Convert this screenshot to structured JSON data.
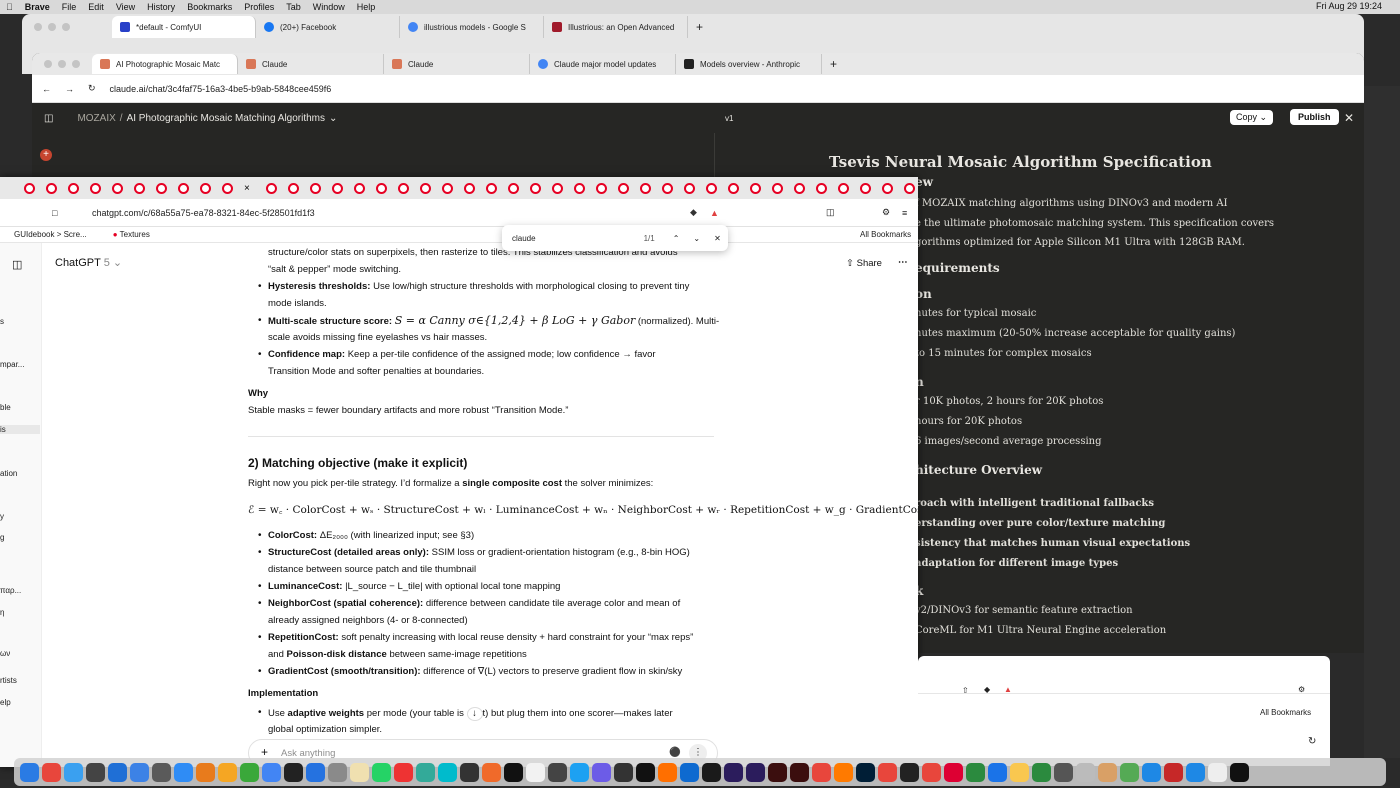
{
  "menubar": {
    "app": "Brave",
    "items": [
      "File",
      "Edit",
      "View",
      "History",
      "Bookmarks",
      "Profiles",
      "Tab",
      "Window",
      "Help"
    ],
    "clock": "Fri Aug 29  19:24"
  },
  "window_back": {
    "tabs": [
      "*default - ComfyUI",
      "(20+) Facebook",
      "illustrious models - Google S",
      "Illustrious: an Open Advanced"
    ]
  },
  "window_claude": {
    "tabs": [
      "AI Photographic Mosaic Matc",
      "Claude",
      "Claude",
      "Claude major model updates",
      "Models overview - Anthropic"
    ],
    "url": "claude.ai/chat/3c4faf75-16a3-4be5-b9ab-5848cee459f6",
    "breadcrumb_project": "MOZAIX",
    "breadcrumb_sep": "/",
    "chat_title": "AI Photographic Mosaic Matching Algorithms",
    "version": "v1",
    "copy_label": "Copy",
    "publish_label": "Publish",
    "artifact": {
      "title": "Tsevis Neural Mosaic Algorithm Specification",
      "lines": [
        {
          "t": "ew",
          "k": "h"
        },
        {
          "t": "f MOZAIX matching algorithms using DINOv3 and modern AI",
          "k": "p"
        },
        {
          "t": "e the ultimate photomosaic matching system. This specification covers",
          "k": "p"
        },
        {
          "t": "gorithms optimized for Apple Silicon M1 Ultra with 128GB RAM.",
          "k": "p"
        },
        {
          "t": "equirements",
          "k": "h"
        },
        {
          "t": "on",
          "k": "h"
        },
        {
          "t": "nutes for typical mosaic",
          "k": "p"
        },
        {
          "t": "nutes maximum (20-50% increase acceptable for quality gains)",
          "k": "p"
        },
        {
          "t": "to 15 minutes for complex mosaics",
          "k": "p"
        },
        {
          "t": "n",
          "k": "h"
        },
        {
          "t": "r 10K photos, 2 hours for 20K photos",
          "k": "p"
        },
        {
          "t": "hours for 20K photos",
          "k": "p"
        },
        {
          "t": "6 images/second average processing",
          "k": "p"
        },
        {
          "t": "hitecture Overview",
          "k": "h"
        },
        {
          "t": "roach with intelligent traditional fallbacks",
          "k": "pb"
        },
        {
          "t": "erstanding over pure color/texture matching",
          "k": "pb"
        },
        {
          "t": "sistency that matches human visual expectations",
          "k": "pb"
        },
        {
          "t": "adaptation for different image types",
          "k": "pb"
        },
        {
          "t": "k",
          "k": "h"
        },
        {
          "t": "v2/DINOv3 for semantic feature extraction",
          "k": "p"
        },
        {
          "t": "CoreML for M1 Ultra Neural Engine acceleration",
          "k": "p"
        }
      ]
    }
  },
  "window_chatgpt": {
    "url": "chatgpt.com/c/68a55a75-ea78-8321-84ec-5f28501fd1f3",
    "bookmarks": [
      "GUIdebook > Scre...",
      "Textures"
    ],
    "all_bookmarks": "All Bookmarks",
    "model": "ChatGPT",
    "model_version": "5",
    "share_label": "Share",
    "find": {
      "query": "claude",
      "count": "1/1"
    },
    "sidebar_items": [
      "s",
      "mpar...",
      "ble",
      "is",
      "ation",
      "y",
      "g",
      "παρ...",
      "η",
      "ων",
      "rtists",
      "elp"
    ],
    "content": {
      "l1": "structure/color stats on superpixels, then rasterize to tiles. This stabilizes classification and avoids",
      "l2": "“salt & pepper” mode switching.",
      "hyst_b": "Hysteresis thresholds:",
      "hyst_t": " Use low/high structure thresholds with morphological closing to prevent tiny",
      "hyst_2": "mode islands.",
      "ms_b": "Multi-scale structure score:",
      "ms_math": "S = α Canny σ∈{1,2,4} + β LoG + γ Gabor",
      "ms_t": " (normalized). Multi-",
      "ms_2": "scale avoids missing fine eyelashes vs hair masses.",
      "conf_b": "Confidence map:",
      "conf_t": " Keep a per-tile confidence of the assigned mode; low confidence → favor",
      "conf_2": "Transition Mode and softer penalties at boundaries.",
      "why_h": "Why",
      "why_t": "Stable masks = fewer boundary artifacts and more robust “Transition Mode.”",
      "sec_h": "2) Matching objective (make it explicit)",
      "sec_p1": "Right now you pick per-tile strategy. I’d formalize a ",
      "sec_pb": "single composite cost",
      "sec_p2": " the solver minimizes:",
      "eq": "ℰ = w꜀ · ColorCost + wₛ · StructureCost + wₗ · LuminanceCost + wₙ · NeighborCost + wᵣ · RepetitionCost + w_g · GradientCost",
      "c1_b": "ColorCost:",
      "c1_t": " ΔE₂₀₀₀ (with linearized input; see §3)",
      "c2_b": "StructureCost (detailed areas only):",
      "c2_t": " SSIM loss or gradient-orientation histogram (e.g., 8-bin HOG)",
      "c2_2": "distance between source patch and tile thumbnail",
      "c3_b": "LuminanceCost:",
      "c3_t": " |L_source − L_tile| with optional local tone mapping",
      "c4_b": "NeighborCost (spatial coherence):",
      "c4_t": " difference between candidate tile average color and mean of",
      "c4_2": "already assigned neighbors (4- or 8-connected)",
      "c5_b": "RepetitionCost:",
      "c5_t": " soft penalty increasing with local reuse density + hard constraint for your “max reps”",
      "c5_2a": "and ",
      "c5_2b": "Poisson-disk distance",
      "c5_2c": " between same-image repetitions",
      "c6_b": "GradientCost (smooth/transition):",
      "c6_t": " difference of ∇(L) vectors to preserve gradient flow in skin/sky",
      "impl_h": "Implementation",
      "impl_1a": "Use ",
      "impl_1b": "adaptive weights",
      "impl_1c": " per mode (your table is ",
      "impl_1d": "t) but plug them into one scorer—makes later",
      "impl_2": "global optimization simpler.",
      "input_placeholder": "Ask anything"
    }
  },
  "window_small": {
    "all_bookmarks": "All Bookmarks"
  },
  "colors": {
    "claude_bg": "#262624",
    "brave": "#fb542b",
    "pinterest": "#e60023",
    "accent_orange": "#d97757"
  }
}
